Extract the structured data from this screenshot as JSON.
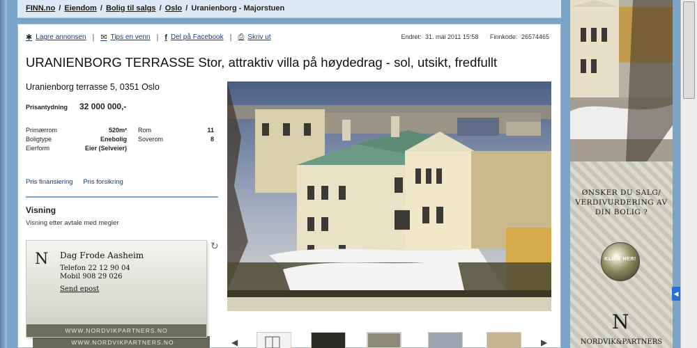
{
  "breadcrumb": {
    "items": [
      "FINN.no",
      "Eiendom",
      "Bolig til salgs",
      "Oslo",
      "Uranienborg - Majorstuen"
    ]
  },
  "actions": {
    "save": "Lagre annonsen",
    "tip": "Tips en venn",
    "facebook": "Del på Facebook",
    "print": "Skriv ut"
  },
  "meta": {
    "updated_label": "Endret:",
    "updated_value": "31. mai 2011 15:58",
    "code_label": "Finnkode:",
    "code_value": "26574465"
  },
  "listing": {
    "title": "URANIENBORG TERRASSE Stor, attraktiv villa på høydedrag - sol, utsikt, fredfullt",
    "address": "Uranienborg terrasse 5, 0351 Oslo",
    "price_label": "Prisantydning",
    "price_value": "32 000 000,-",
    "facts": [
      {
        "k1": "Primærrom",
        "v1": "520m²",
        "k2": "Rom",
        "v2": "11"
      },
      {
        "k1": "Boligtype",
        "v1": "Enebolig",
        "k2": "Soverom",
        "v2": "8"
      },
      {
        "k1": "Eierform",
        "v1": "Eier (Selveier)",
        "k2": "",
        "v2": ""
      }
    ],
    "links": {
      "financing": "Pris finansiering",
      "insurance": "Pris forsikring"
    },
    "visning_heading": "Visning",
    "visning_text": "Visning etter avtale med megler"
  },
  "agent": {
    "logo": "N",
    "name": "Dag Frode Aasheim",
    "phone": "Telefon  22 12 90 04",
    "mobile": "Mobil  908 29 026",
    "email": "Send epost",
    "url": "WWW.NORDVIKPARTNERS.NO"
  },
  "ad": {
    "text": "ØNSKER DU SALG/ VERDIVURDERING AV DIN BOLIG ?",
    "button": "KLIKK HER!",
    "logo": "N",
    "brand": "NORDVIK&PARTNERS"
  },
  "colors": {
    "link": "#123e7a",
    "accent": "#7aa5c9"
  }
}
